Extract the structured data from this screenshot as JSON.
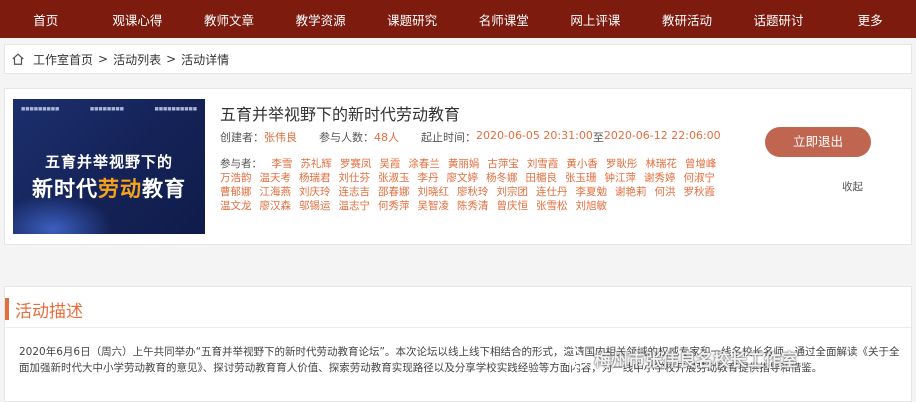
{
  "nav": [
    "首页",
    "观课心得",
    "教师文章",
    "教学资源",
    "课题研究",
    "名师课堂",
    "网上评课",
    "教研活动",
    "话题研讨",
    "更多"
  ],
  "breadcrumb": {
    "home": "工作室首页",
    "list": "活动列表",
    "detail": "活动详情"
  },
  "cover": {
    "line1": "五育并举视野下的",
    "line2a": "新时代",
    "line2b": "劳动",
    "line2c": "教育"
  },
  "activity": {
    "title": "五育并举视野下的新时代劳动教育",
    "creator_label": "创建者：",
    "creator": "张伟良",
    "count_label": "参与人数：",
    "count": "48人",
    "time_label": "起止时间：",
    "start": "2020-06-05 20:31:00",
    "to": "至",
    "end": "2020-06-12 22:06:00",
    "participants_label": "参与者：",
    "participants": [
      "李雪",
      "苏礼辉",
      "罗赛凤",
      "吴霞",
      "涂春兰",
      "黄丽娟",
      "古萍宝",
      "刘雪霞",
      "黄小香",
      "罗耿彤",
      "林瑞花",
      "曾增峰",
      "万浩韵",
      "温天考",
      "杨瑞君",
      "刘仕芬",
      "张淑玉",
      "李丹",
      "廖文婷",
      "杨冬娜",
      "田楣良",
      "张玉珊",
      "钟江萍",
      "谢秀婷",
      "何淑宁",
      "曹郁娜",
      "江海燕",
      "刘庆玲",
      "连志吉",
      "邵春娜",
      "刘晓红",
      "廖秋玲",
      "刘宗团",
      "连仕丹",
      "李夏勉",
      "谢艳莉",
      "何洪",
      "罗秋霞",
      "温文龙",
      "廖汉森",
      "邬锡运",
      "温志宁",
      "何秀萍",
      "吴智凌",
      "陈秀清",
      "曾庆恒",
      "张雪松",
      "刘旭敏"
    ],
    "quit_button": "立即退出",
    "collapse": "收起"
  },
  "description": {
    "heading": "活动描述",
    "text": "2020年6月6日（周六）上午共同举办“五育并举视野下的新时代劳动教育论坛”。本次论坛以线上线下相结合的形式，邀请国内相关领域的权威专家和一线名校长名师，通过全面解读《关于全面加强新时代大中小学劳动教育的意见》、探讨劳动教育育人价值、探索劳动教育实现路径以及分享学校实践经验等方面内容，为一线中小学校开展劳动教育提供指导和借鉴。"
  },
  "watermark": "梅州市张伟良名校长工作室"
}
